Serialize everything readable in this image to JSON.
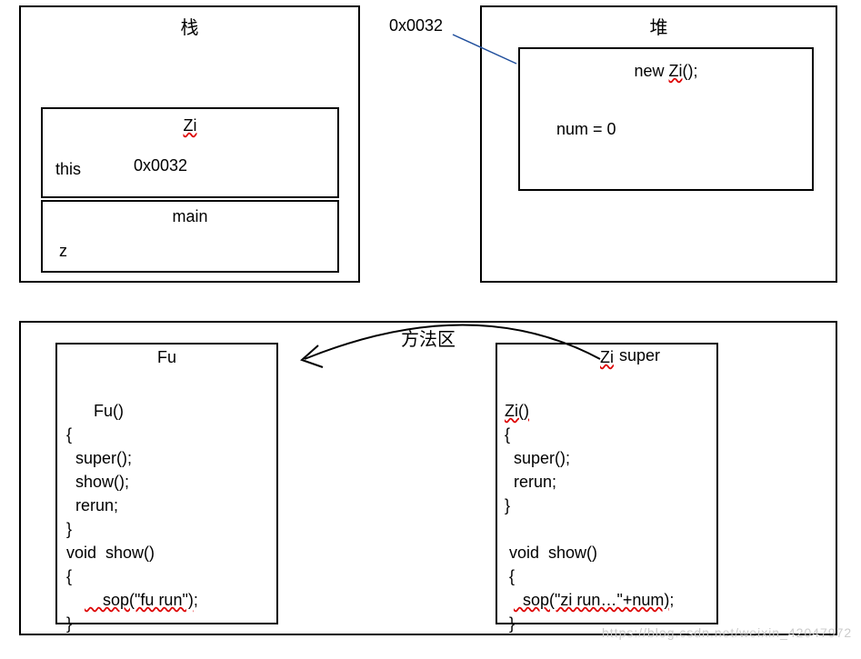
{
  "stack": {
    "title": "栈",
    "frame_zi": {
      "title": "Zi",
      "this_label": "this",
      "address": "0x0032"
    },
    "frame_main": {
      "title": "main",
      "var": "z"
    }
  },
  "pointer_addr": "0x0032",
  "heap": {
    "title": "堆",
    "object": {
      "ctor": "new  Zi();",
      "ctor_plain": "new  ",
      "ctor_id": "Zi",
      "ctor_tail": "();",
      "field": "num  = 0"
    }
  },
  "method_area": {
    "title": "方法区",
    "super_label": "super",
    "fu": {
      "title": "Fu",
      "code_lines": [
        "Fu()",
        "{",
        "  super();",
        "  show();",
        "  rerun;",
        "}",
        "void  show()",
        "{",
        "    sop(\"fu run\");",
        "}"
      ]
    },
    "zi": {
      "title": "Zi",
      "code_lines": [
        "Zi()",
        "{",
        "  super();",
        "  rerun;",
        "}",
        "",
        " void  show()",
        " {",
        "  sop(\"zi run…\"+num);",
        " }"
      ]
    }
  },
  "watermark": "https://blog.csdn.net/weixin_42047972"
}
